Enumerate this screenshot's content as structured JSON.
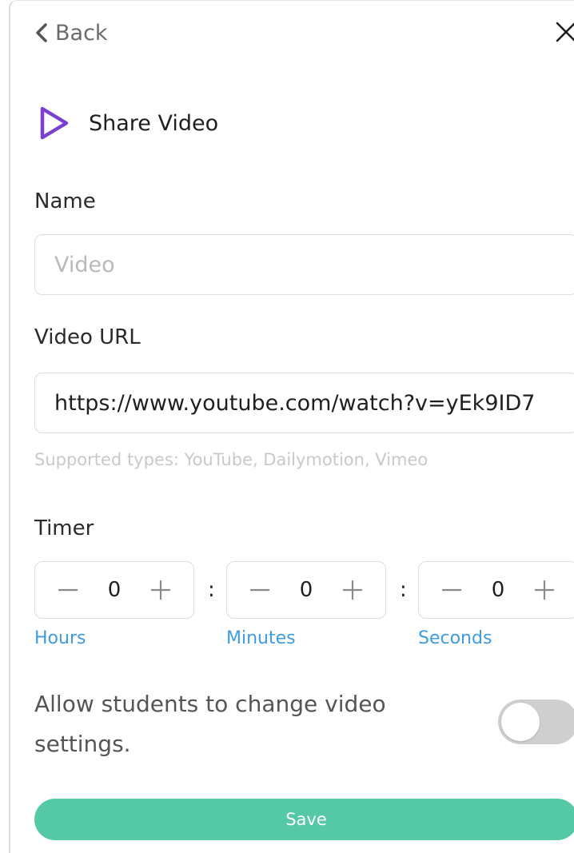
{
  "nav": {
    "back_label": "Back",
    "back_icon": "chevron-left-icon",
    "close_icon": "close-icon"
  },
  "header": {
    "icon": "play-icon",
    "title": "Share Video",
    "icon_color": "#7b3fd1"
  },
  "name_field": {
    "label": "Name",
    "placeholder": "Video",
    "value": ""
  },
  "url_field": {
    "label": "Video URL",
    "value": "https://www.youtube.com/watch?v=yEk9ID7",
    "hint": "Supported types: YouTube, Dailymotion, Vimeo"
  },
  "timer": {
    "label": "Timer",
    "separator": ":",
    "hours": {
      "value": "0",
      "unit": "Hours"
    },
    "minutes": {
      "value": "0",
      "unit": "Minutes"
    },
    "seconds": {
      "value": "0",
      "unit": "Seconds"
    },
    "unit_color": "#3f9ce0"
  },
  "settings": {
    "allow_label": "Allow students to change video settings.",
    "allow_enabled": false
  },
  "actions": {
    "save_label": "Save",
    "save_color": "#55c9a5"
  }
}
